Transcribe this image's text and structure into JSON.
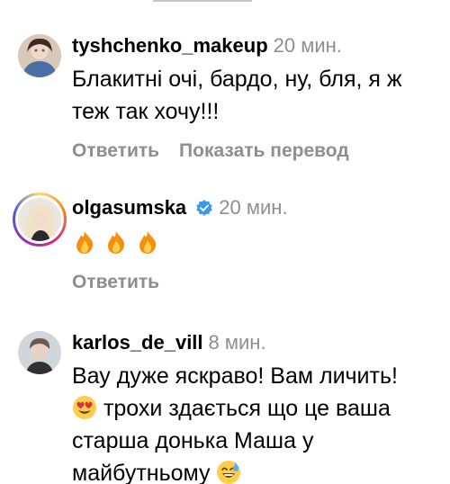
{
  "comments": [
    {
      "username": "tyshchenko_makeup",
      "time": "20 мин.",
      "text": "Блакитні очі, бардо, ну, бля, я ж теж так хочу!!!",
      "actions": [
        "Ответить",
        "Показать перевод"
      ]
    },
    {
      "username": "olgasumska",
      "verified": true,
      "time": "20 мин.",
      "emojis": [
        "fire-emoji",
        "fire-emoji",
        "fire-emoji"
      ],
      "actions": [
        "Ответить"
      ]
    },
    {
      "username": "karlos_de_vill",
      "time": "8 мин.",
      "text_before": "Вау дуже яскраво! Вам личить!",
      "text_middle": "трохи здається що це ваша старша донька Маша у майбутньому",
      "emojis": [
        "heart-eyes-emoji",
        "sweat-smile-emoji"
      ]
    }
  ],
  "colors": {
    "secondary_text": "#8e8e8e",
    "verified_blue": "#3897f0"
  }
}
